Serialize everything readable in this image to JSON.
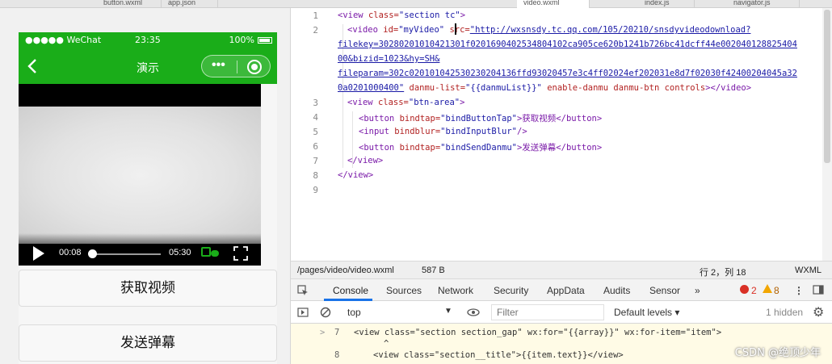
{
  "tabs": [
    "button.wxml",
    "app.json",
    "video.wxml",
    "index.js",
    "navigator.js"
  ],
  "simulator": {
    "status": {
      "signal": "●●●●● WeChat",
      "time": "23:35",
      "battery": "100%"
    },
    "nav_title": "演示",
    "capsule_more": "•••",
    "video": {
      "current_time": "00:08",
      "total_time": "05:30",
      "progress": 0.02
    },
    "buttons": [
      "获取视频",
      "发送弹幕"
    ]
  },
  "editor": {
    "line_numbers": [
      "1",
      "2",
      "3",
      "4",
      "5",
      "6",
      "7",
      "8",
      "9"
    ],
    "line1": {
      "open": "<view ",
      "attr": "class=",
      "val": "\"section tc\"",
      "close": ">"
    },
    "line2": {
      "open": "<video ",
      "id_attr": "id=",
      "id_val": "\"myVideo\" ",
      "src_attr": "src=",
      "url1": "\"http://wxsnsdy.tc.qq.com/105/20210/snsdyvideodownload?",
      "url2": "filekey=30280201010421301f0201690402534804102ca905ce620b1241b726bc41dcff44e002040128825404",
      "url3": "00&bizid=1023&hy=SH&",
      "url4": "fileparam=302c020101042530230204136ffd93020457e3c4ff02024ef202031e8d7f02030f42400204045a32",
      "url5_link": "0a0201000400\"",
      "danmu_attr": " danmu-list=",
      "danmu_val": "\"{{danmuList}}\"",
      "rest_attr": " enable-danmu danmu-btn controls",
      "close": "></video>"
    },
    "line3": {
      "open": "<view ",
      "attr": "class=",
      "val": "\"btn-area\"",
      "close": ">"
    },
    "line4": {
      "open": "<button ",
      "attr": "bindtap=",
      "val": "\"bindButtonTap\"",
      "text": ">获取视频</button>"
    },
    "line5": {
      "open": "<input ",
      "attr": "bindblur=",
      "val": "\"bindInputBlur\"",
      "close": "/>"
    },
    "line6": {
      "open": "<button ",
      "attr": "bindtap=",
      "val": "\"bindSendDanmu\"",
      "text": ">发送弹幕</button>"
    },
    "line7": "</view>",
    "line8": "</view>"
  },
  "statusline": {
    "path": "/pages/video/video.wxml",
    "size": "587 B",
    "position": "行 2，列 18",
    "lang": "WXML"
  },
  "devtools": {
    "tabs": [
      "Console",
      "Sources",
      "Network",
      "Security",
      "AppData",
      "Audits",
      "Sensor",
      "»"
    ],
    "errors": "2",
    "warnings": "8",
    "context": "top",
    "filter_placeholder": "Filter",
    "levels": "Default levels ▾",
    "hidden": "1 hidden",
    "console_lines": [
      {
        "num": "7",
        "text": "<view class=\"section section_gap\" wx:for=\"{{array}}\" wx:for-item=\"item\">"
      },
      {
        "num": "",
        "text": "^"
      },
      {
        "num": "8",
        "text": "<view class=\"section__title\">{{item.text}}</view>"
      }
    ]
  },
  "watermark": "CSDN @绝顶少年"
}
